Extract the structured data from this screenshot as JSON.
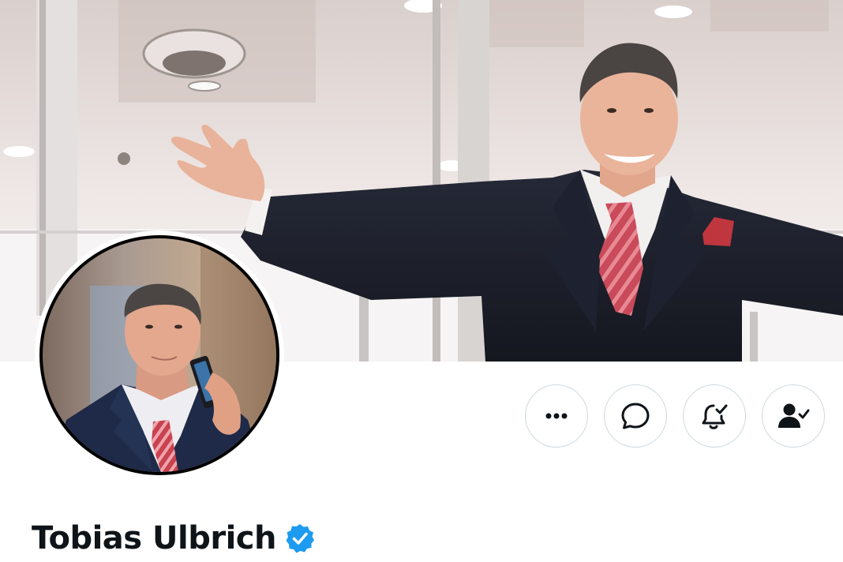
{
  "profile": {
    "display_name": "Tobias Ulbrich",
    "verified": true,
    "banner_image": "header-photo",
    "avatar_image": "profile-photo"
  },
  "actions": [
    {
      "name": "more-button",
      "icon": "more-dots-icon"
    },
    {
      "name": "message-button",
      "icon": "message-bubble-icon"
    },
    {
      "name": "notifications-button",
      "icon": "bell-check-icon"
    },
    {
      "name": "following-button",
      "icon": "person-check-icon"
    }
  ],
  "colors": {
    "verified_badge": "#1d9bf0",
    "text_primary": "#0f1419",
    "button_border": "#cfd9de",
    "suit": "#1b1e2a",
    "tie": "#c94a5a"
  }
}
